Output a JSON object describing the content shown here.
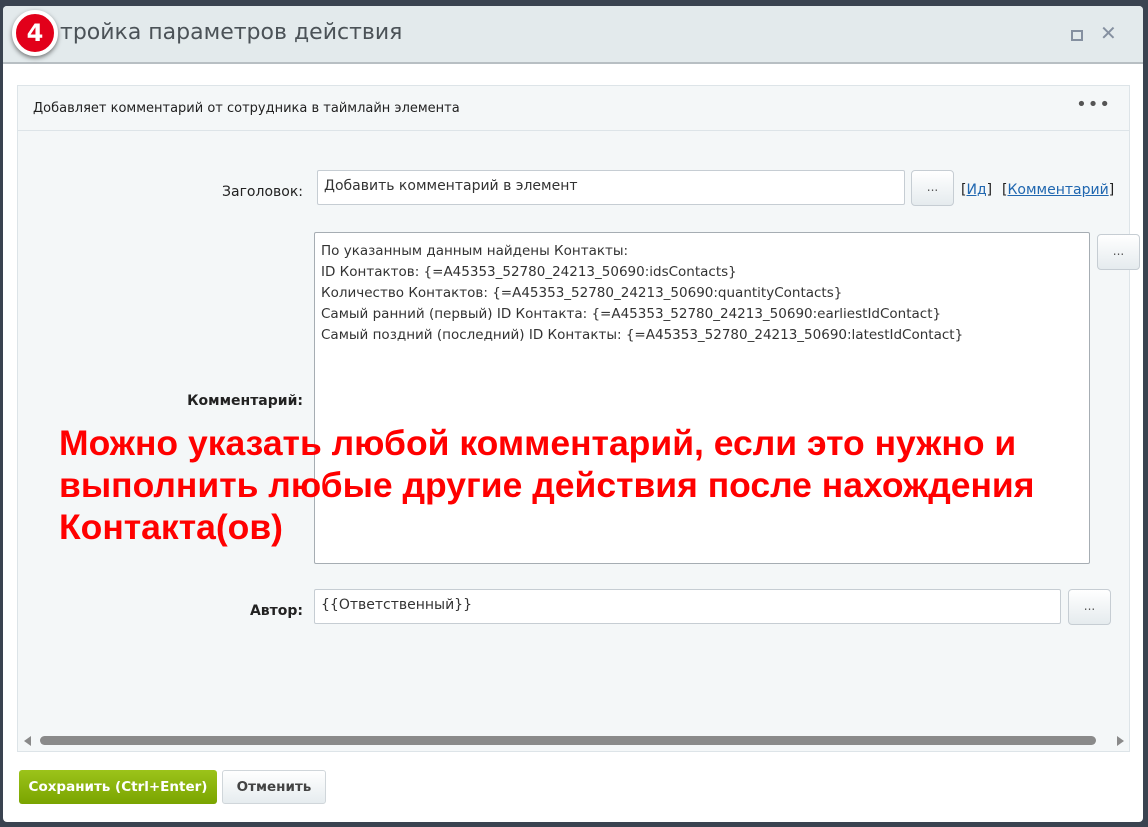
{
  "dialog": {
    "title": "тройка параметров действия",
    "step_badge": "4",
    "maximize_icon": "maximize-icon",
    "close_icon": "close-icon"
  },
  "panel": {
    "description": "Добавляет комментарий от сотрудника в таймлайн элемента",
    "menu_icon": "more-dots-icon"
  },
  "form": {
    "title_label": "Заголовок:",
    "title_value": "Добавить комментарий в элемент",
    "picker_label": "...",
    "link_id": "Ид",
    "link_comment": "Комментарий",
    "comment_label": "Комментарий:",
    "comment_lines": [
      "По указанным данным найдены Контакты:",
      "ID Контактов: {=A45353_52780_24213_50690:idsContacts}",
      "Количество Контактов: {=A45353_52780_24213_50690:quantityContacts}",
      "Самый ранний (первый) ID Контакта: {=A45353_52780_24213_50690:earliestIdContact}",
      "Самый поздний (последний) ID Контакты: {=A45353_52780_24213_50690:latestIdContact}"
    ],
    "author_label": "Автор:",
    "author_value": "{{Ответственный}}"
  },
  "annotation": "Можно указать любой комментарий, если это нужно и\nвыполнить любые другие действия после нахождения\nКонтакта(ов)",
  "footer": {
    "save_label": "Сохранить (Ctrl+Enter)",
    "cancel_label": "Отменить"
  },
  "colors": {
    "save": "#7aa400",
    "annotation": "#ff0000",
    "badge": "#e2001a",
    "link": "#2067b0"
  }
}
